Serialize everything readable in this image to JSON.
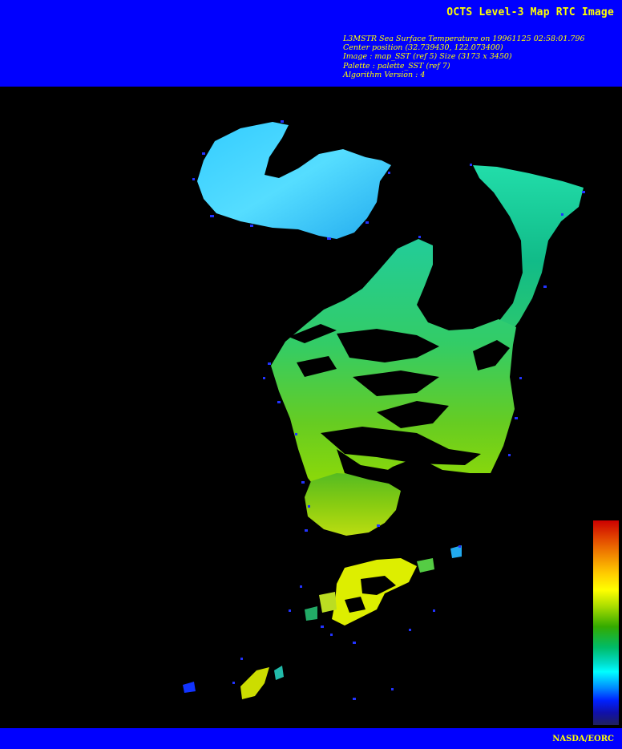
{
  "header": {
    "title": "OCTS Level-3 Map RTC Image",
    "lines": [
      "L3MSTR Sea Surface Temperature on 19961125 02:58:01.796",
      "Center position (32.739430, 122.073400)",
      "Image : map_SST (ref 5) Size (3173 x 3450)",
      "Palette : palette_SST (ref 7)",
      "Algorithm Version : 4"
    ]
  },
  "colors": {
    "banner": "#0000ff",
    "text": "#ffff00",
    "background": "#000000"
  },
  "colorbar": {
    "name": "sst-palette"
  },
  "footer": {
    "credit": "NASDA/EORC"
  }
}
